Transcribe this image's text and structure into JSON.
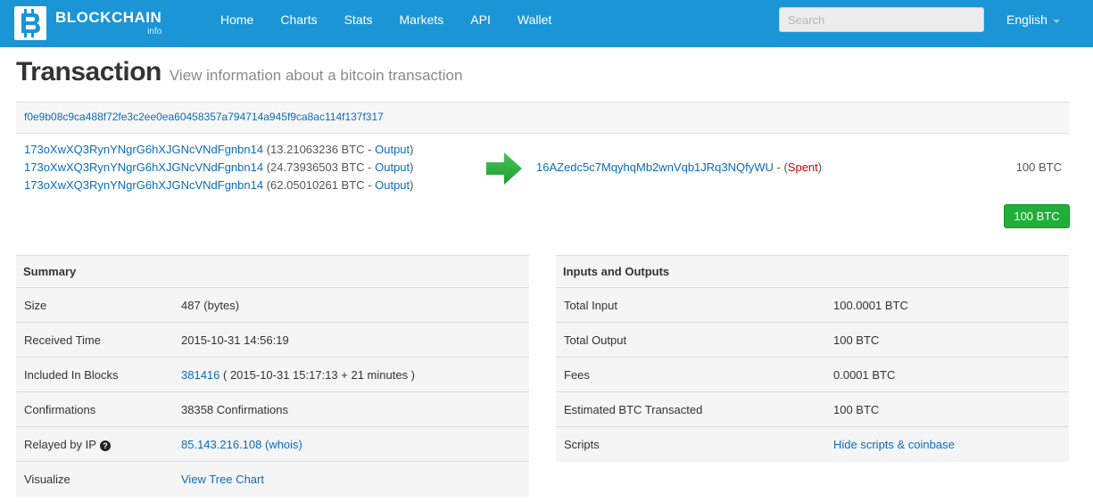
{
  "navbar": {
    "brand_name": "BLOCKCHAIN",
    "brand_sub": "info",
    "items": [
      "Home",
      "Charts",
      "Stats",
      "Markets",
      "API",
      "Wallet"
    ],
    "search_placeholder": "Search",
    "language": "English"
  },
  "header": {
    "title": "Transaction",
    "subtitle": "View information about a bitcoin transaction"
  },
  "transaction": {
    "hash": "f0e9b08c9ca488f72fe3c2ee0ea60458357a794714a945f9ca8ac114f137f317",
    "inputs": [
      {
        "address": "173oXwXQ3RynYNgrG6hXJGNcVNdFgnbn14",
        "amount": " (13.21063236 BTC - ",
        "output_label": "Output",
        "close": ")"
      },
      {
        "address": "173oXwXQ3RynYNgrG6hXJGNcVNdFgnbn14",
        "amount": " (24.73936503 BTC - ",
        "output_label": "Output",
        "close": ")"
      },
      {
        "address": "173oXwXQ3RynYNgrG6hXJGNcVNdFgnbn14",
        "amount": " (62.05010261 BTC - ",
        "output_label": "Output",
        "close": ")"
      }
    ],
    "output": {
      "address": "16AZedc5c7MqyhqMb2wnVqb1JRq3NQfyWU",
      "separator": " - (",
      "status": "Spent",
      "close": ")",
      "amount": "100 BTC"
    },
    "total_button": "100 BTC",
    "arrow_color": "#2db340"
  },
  "summary": {
    "heading": "Summary",
    "size_label": "Size",
    "size_value": "487 (bytes)",
    "received_label": "Received Time",
    "received_value": "2015-10-31 14:56:19",
    "blocks_label": "Included In Blocks",
    "block_link": "381416",
    "block_detail": " ( 2015-10-31 15:17:13 + 21 minutes )",
    "confirmations_label": "Confirmations",
    "confirmations_value": "38358 Confirmations",
    "relayed_label": "Relayed by IP",
    "relayed_help": "?",
    "relayed_ip": "85.143.216.108 (whois)",
    "visualize_label": "Visualize",
    "visualize_link": "View Tree Chart"
  },
  "io": {
    "heading": "Inputs and Outputs",
    "total_input_label": "Total Input",
    "total_input_value": "100.0001 BTC",
    "total_output_label": "Total Output",
    "total_output_value": "100 BTC",
    "fees_label": "Fees",
    "fees_value": "0.0001 BTC",
    "estimated_label": "Estimated BTC Transacted",
    "estimated_value": "100 BTC",
    "scripts_label": "Scripts",
    "scripts_link": "Hide scripts & coinbase"
  }
}
